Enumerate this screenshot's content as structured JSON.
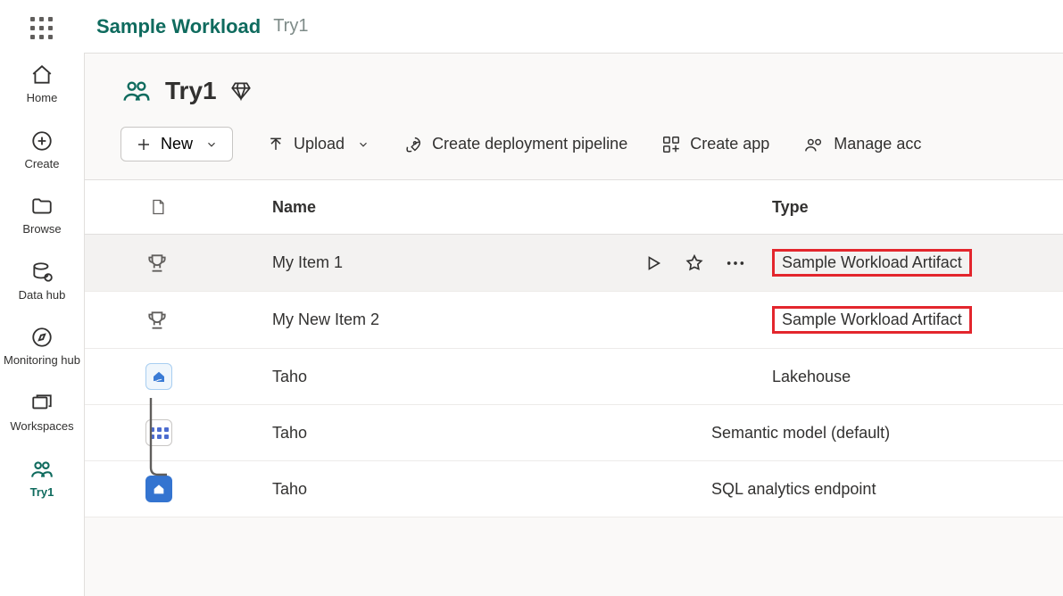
{
  "breadcrumb": {
    "app": "Sample Workload",
    "workspace": "Try1"
  },
  "nav": {
    "home": "Home",
    "create": "Create",
    "browse": "Browse",
    "datahub": "Data hub",
    "monitoring": "Monitoring hub",
    "workspaces": "Workspaces",
    "current": "Try1"
  },
  "workspace": {
    "title": "Try1"
  },
  "toolbar": {
    "new": "New",
    "upload": "Upload",
    "pipeline": "Create deployment pipeline",
    "createapp": "Create app",
    "manageaccess": "Manage acc"
  },
  "columns": {
    "name": "Name",
    "type": "Type"
  },
  "rows": [
    {
      "name": "My Item 1",
      "type": "Sample Workload Artifact",
      "icon": "trophy",
      "highlight": true,
      "hover": true
    },
    {
      "name": "My New Item 2",
      "type": "Sample Workload Artifact",
      "icon": "trophy",
      "highlight": true
    },
    {
      "name": "Taho",
      "type": "Lakehouse",
      "icon": "lakehouse"
    },
    {
      "name": "Taho",
      "type": "Semantic model (default)",
      "icon": "semantic",
      "child": true
    },
    {
      "name": "Taho",
      "type": "SQL analytics endpoint",
      "icon": "sql",
      "child": true
    }
  ]
}
